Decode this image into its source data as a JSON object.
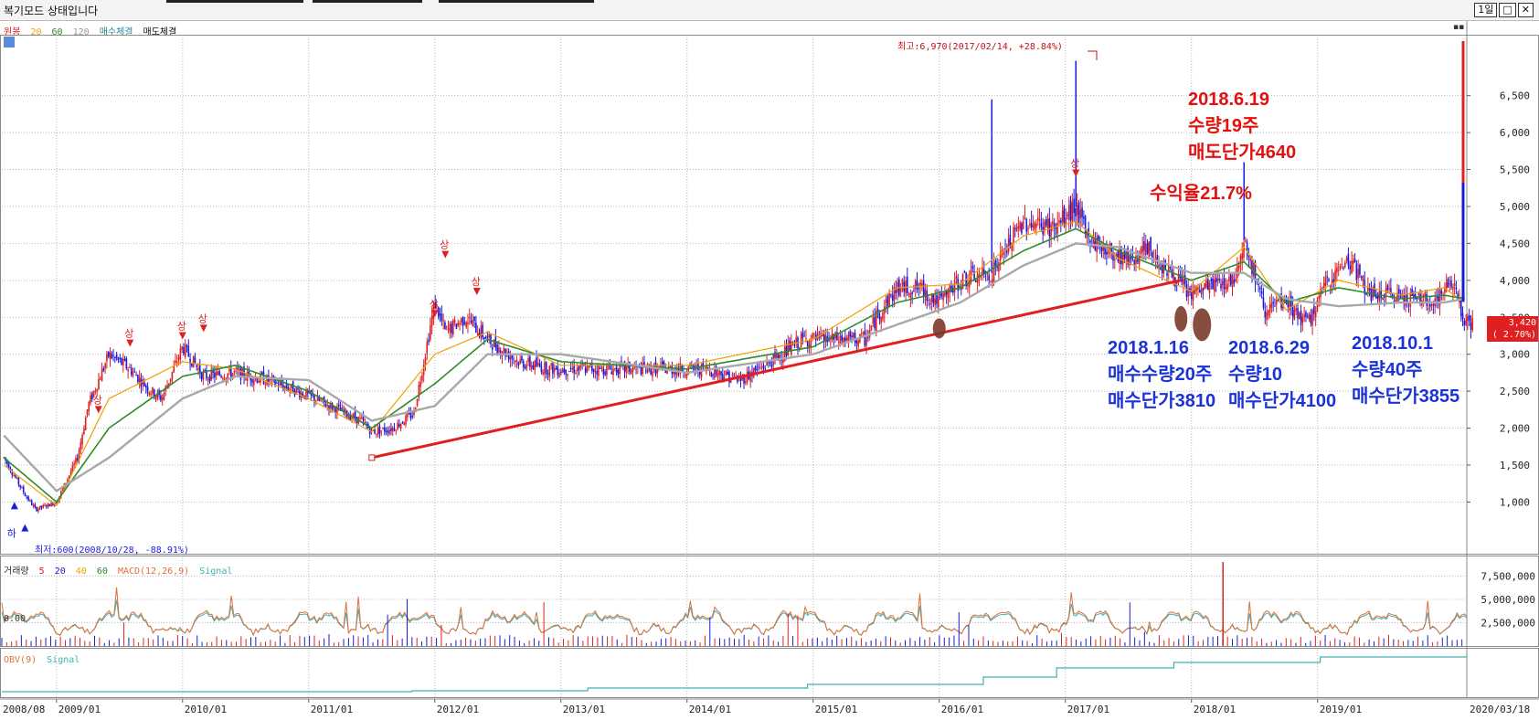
{
  "window": {
    "title": "복기모드 상태입니다",
    "period_button": "1일",
    "restore_btn": "□",
    "close_btn": "✕"
  },
  "price_pane": {
    "legend": {
      "price": "원봉",
      "ma20": "20",
      "ma60": "60",
      "ma120": "120",
      "buy_exec": "매수체결",
      "sell_exec": "매도체결"
    },
    "high_label": "최고:6,970(2017/02/14, +28.84%)",
    "low_label": "최저:600(2008/10/28, -88.91%)",
    "current_price": "3,420",
    "current_change": "( 2.70%)",
    "marker_up": "상",
    "marker_down": "하"
  },
  "volume_pane": {
    "legend": {
      "volume": "거래량",
      "v5": "5",
      "v20": "20",
      "v40": "40",
      "v60": "60",
      "macd": "MACD(12,26,9)",
      "signal": "Signal"
    },
    "zero_label": "0.00"
  },
  "obv_pane": {
    "legend": {
      "obv": "OBV(9)",
      "signal": "Signal"
    }
  },
  "annotations": {
    "sell": [
      "2018.6.19",
      "수량19주",
      "매도단가4640"
    ],
    "profit": "수익율21.7%",
    "buy1": [
      "2018.1.16",
      "매수수량20주",
      "매수단가3810"
    ],
    "buy2": [
      "2018.6.29",
      "수량10",
      "매수단가4100"
    ],
    "buy3": [
      "2018.10.1",
      "수량40주",
      "매수단가3855"
    ]
  },
  "colors": {
    "candle_up": "#e02020",
    "candle_down": "#1a1ae0",
    "ma20": "#f0a000",
    "ma60": "#2e8b2e",
    "ma120": "#a8a8a8",
    "trendline": "#e02020",
    "annotation_red": "#e31010",
    "annotation_blue": "#1a32d8",
    "grid": "#b9b9b9",
    "macd": "#e0703a",
    "signal": "#40b0b0"
  },
  "chart_data": [
    {
      "type": "line",
      "panel": "price",
      "ylim": [
        300,
        7300
      ],
      "yticks": [
        1000,
        1500,
        2000,
        2500,
        3000,
        3500,
        4000,
        4500,
        5000,
        5500,
        6000,
        6500
      ],
      "ytick_labels": [
        "1,000",
        "1,500",
        "2,000",
        "2,500",
        "3,000",
        "3,500",
        "4,000",
        "4,500",
        "5,000",
        "5,500",
        "6,000",
        "6,500"
      ],
      "xticks": [
        "2008/08",
        "2009/01",
        "2010/01",
        "2011/01",
        "2012/01",
        "2013/01",
        "2014/01",
        "2015/01",
        "2016/01",
        "2017/01",
        "2018/01",
        "2019/01",
        "2020/03/18"
      ],
      "x_range": [
        "2008-08",
        "2020-03"
      ],
      "series": [
        {
          "name": "원봉",
          "x": [
            "2008-08",
            "2008-10",
            "2008-11",
            "2009-01",
            "2009-03",
            "2009-04",
            "2009-06",
            "2009-08",
            "2009-10",
            "2009-11",
            "2010-01",
            "2010-03",
            "2010-06",
            "2010-09",
            "2010-12",
            "2011-03",
            "2011-06",
            "2011-07",
            "2011-09",
            "2011-11",
            "2012-01",
            "2012-02",
            "2012-04",
            "2012-06",
            "2012-09",
            "2012-12",
            "2013-03",
            "2013-06",
            "2013-09",
            "2013-12",
            "2014-03",
            "2014-06",
            "2014-09",
            "2014-12",
            "2015-03",
            "2015-06",
            "2015-07",
            "2015-09",
            "2015-11",
            "2016-01",
            "2016-03",
            "2016-06",
            "2016-09",
            "2016-12",
            "2017-02",
            "2017-03",
            "2017-05",
            "2017-07",
            "2017-09",
            "2017-11",
            "2018-01",
            "2018-03",
            "2018-05",
            "2018-06",
            "2018-08",
            "2018-10",
            "2018-12",
            "2019-02",
            "2019-04",
            "2019-06",
            "2019-09",
            "2019-12",
            "2020-02",
            "2020-03"
          ],
          "values": [
            1600,
            1100,
            900,
            1000,
            1600,
            2300,
            3000,
            2800,
            2500,
            2400,
            3100,
            2700,
            2750,
            2650,
            2500,
            2300,
            2100,
            1950,
            2000,
            2200,
            3700,
            3300,
            3500,
            3200,
            2900,
            2800,
            2800,
            2800,
            2800,
            2800,
            2800,
            2650,
            2900,
            3200,
            3200,
            3200,
            3500,
            3900,
            3900,
            3700,
            4000,
            4100,
            4800,
            4700,
            5000,
            4600,
            4400,
            4300,
            4400,
            4100,
            3800,
            3950,
            4000,
            4550,
            3600,
            3700,
            3400,
            4000,
            4300,
            3800,
            3800,
            3700,
            4000,
            3420
          ]
        },
        {
          "name": "20",
          "x": [
            "2008-08",
            "2009-01",
            "2009-06",
            "2010-01",
            "2010-06",
            "2011-01",
            "2011-07",
            "2012-01",
            "2012-06",
            "2013-01",
            "2014-01",
            "2015-01",
            "2015-09",
            "2016-03",
            "2016-09",
            "2017-02",
            "2017-06",
            "2018-01",
            "2018-06",
            "2018-10",
            "2019-03",
            "2019-09",
            "2020-01",
            "2020-03"
          ],
          "values": [
            1500,
            950,
            2400,
            2900,
            2800,
            2400,
            1950,
            3000,
            3300,
            2850,
            2850,
            3200,
            3900,
            3950,
            4600,
            4800,
            4300,
            3850,
            4450,
            3600,
            4000,
            3800,
            3900,
            3700
          ]
        },
        {
          "name": "60",
          "x": [
            "2008-08",
            "2009-01",
            "2009-06",
            "2010-01",
            "2010-06",
            "2011-01",
            "2011-07",
            "2012-01",
            "2012-06",
            "2013-01",
            "2014-01",
            "2015-01",
            "2015-09",
            "2016-03",
            "2016-09",
            "2017-02",
            "2017-06",
            "2018-01",
            "2018-06",
            "2018-10",
            "2019-03",
            "2019-09",
            "2020-01",
            "2020-03"
          ],
          "values": [
            1600,
            1000,
            2000,
            2700,
            2850,
            2500,
            2000,
            2600,
            3200,
            2900,
            2800,
            3100,
            3700,
            3900,
            4400,
            4700,
            4400,
            4000,
            4250,
            3700,
            3900,
            3750,
            3800,
            3750
          ]
        },
        {
          "name": "120",
          "x": [
            "2008-08",
            "2009-01",
            "2009-06",
            "2010-01",
            "2010-06",
            "2011-01",
            "2011-07",
            "2012-01",
            "2012-06",
            "2013-01",
            "2014-01",
            "2015-01",
            "2015-09",
            "2016-03",
            "2016-09",
            "2017-02",
            "2017-06",
            "2018-01",
            "2018-06",
            "2018-10",
            "2019-03",
            "2019-09",
            "2020-01",
            "2020-03"
          ],
          "values": [
            1900,
            1150,
            1600,
            2400,
            2700,
            2650,
            2100,
            2300,
            3000,
            3000,
            2750,
            3000,
            3400,
            3700,
            4200,
            4500,
            4450,
            4100,
            4100,
            3750,
            3650,
            3700,
            3700,
            3750
          ]
        },
        {
          "name": "trendline",
          "x": [
            "2011-07",
            "2017-12"
          ],
          "values": [
            1600,
            4000
          ]
        }
      ]
    },
    {
      "type": "line",
      "panel": "volume",
      "yticks": [
        2500000,
        5000000,
        7500000
      ],
      "ytick_labels": [
        "2,500,000",
        "5,000,000",
        "7,500,000"
      ]
    }
  ]
}
